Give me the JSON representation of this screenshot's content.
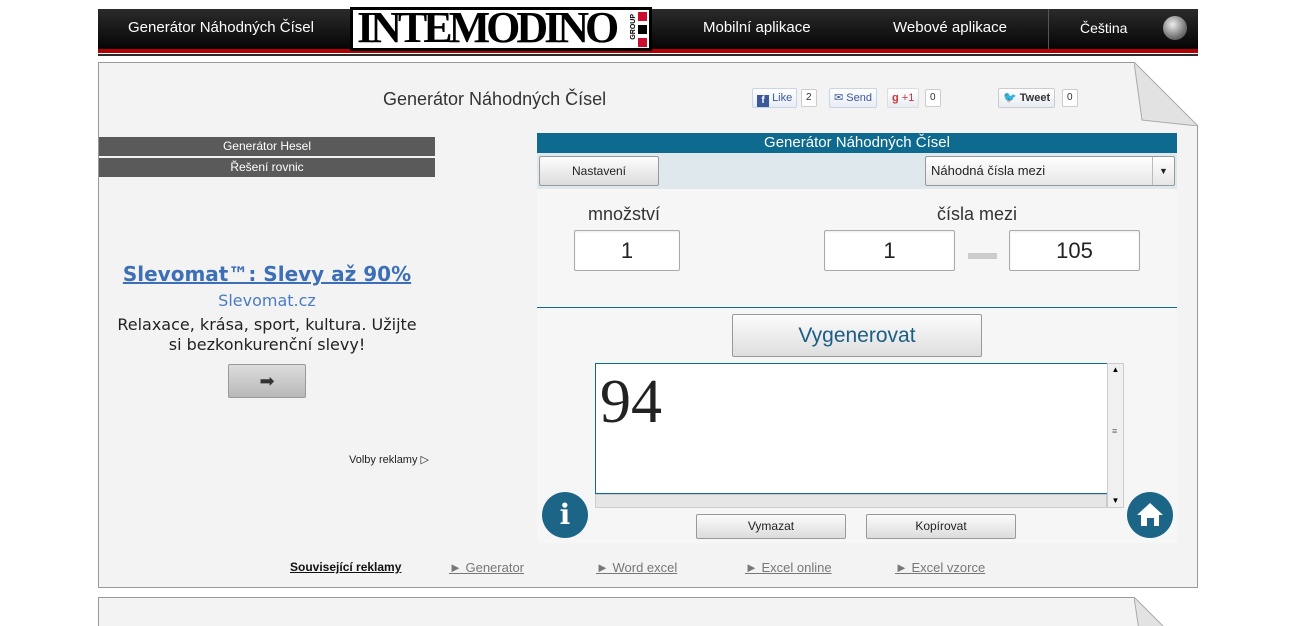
{
  "nav": {
    "left_link": "Generátor Náhodných Čísel",
    "logo_text": "INTEMODINO",
    "logo_group": "GROUP",
    "mobile_apps": "Mobilní aplikace",
    "web_apps": "Webové aplikace",
    "language": "Čeština",
    "globe_icon": "globe-icon"
  },
  "page": {
    "title": "Generátor Náhodných Čísel"
  },
  "social": {
    "like": "Like",
    "like_count": "2",
    "send": "Send",
    "gplus": "+1",
    "gplus_count": "0",
    "tweet": "Tweet",
    "tweet_count": "0"
  },
  "sidebar": {
    "items": [
      {
        "label": "Generátor Hesel"
      },
      {
        "label": "Řešení rovnic"
      }
    ]
  },
  "ad": {
    "title": "Slevomat™: Slevy až 90%",
    "url": "Slevomat.cz",
    "desc_line1": "Relaxace, krása, sport, kultura. Užijte",
    "desc_line2": "si bezkonkurenční slevy!",
    "arrow": "➡",
    "choices": "Volby reklamy"
  },
  "generator": {
    "header": "Generátor Náhodných Čísel",
    "settings_label": "Nastavení",
    "mode_value": "Náhodná čísla mezi",
    "quantity_label": "množství",
    "quantity_value": "1",
    "range_label": "čísla mezi",
    "range_min": "1",
    "range_max": "105",
    "generate_label": "Vygenerovat",
    "result": "94",
    "clear_label": "Vymazat",
    "copy_label": "Kopírovat",
    "info_icon": "info-icon",
    "home_icon": "home-icon"
  },
  "related": {
    "title": "Související reklamy",
    "links": [
      {
        "label": "► Generator"
      },
      {
        "label": "► Word excel"
      },
      {
        "label": "► Excel online"
      },
      {
        "label": "► Excel vzorce"
      }
    ]
  },
  "colors": {
    "accent": "#0e6a8e",
    "nav_bg": "#111111",
    "nav_stripe": "#b30000",
    "ad_link": "#3d6fb6"
  }
}
